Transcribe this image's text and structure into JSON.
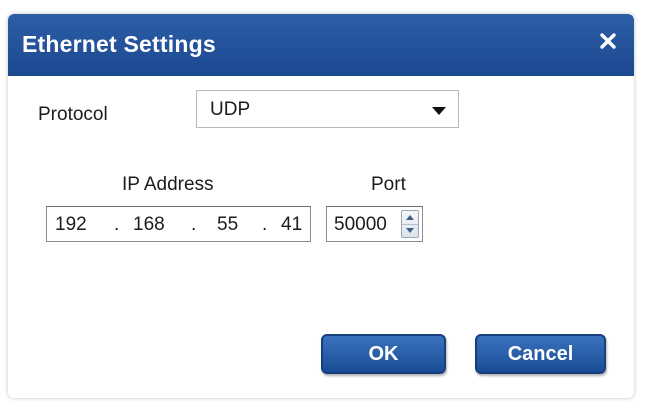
{
  "dialog": {
    "title": "Ethernet Settings",
    "close_icon": "close-icon"
  },
  "protocol": {
    "label": "Protocol",
    "selected": "UDP"
  },
  "ip_address": {
    "label": "IP Address",
    "octets": [
      "192",
      "168",
      "55",
      "41"
    ],
    "separator": "."
  },
  "port": {
    "label": "Port",
    "value": "50000"
  },
  "buttons": {
    "ok_label": "OK",
    "cancel_label": "Cancel"
  },
  "colors": {
    "titlebar": "#1c4891",
    "button": "#2a5ea8"
  }
}
